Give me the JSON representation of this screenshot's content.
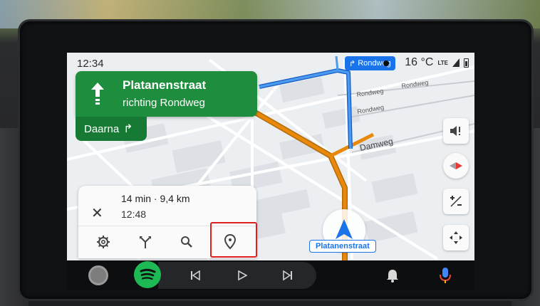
{
  "status": {
    "time": "12:34",
    "temperature": "16 °C",
    "network": "LTE",
    "next_road": "Rondweg"
  },
  "navigation": {
    "street": "Platanenstraat",
    "direction": "richting  Rondweg",
    "then_label": "Daarna"
  },
  "trip": {
    "summary": "14 min · 9,4 km",
    "eta": "12:48"
  },
  "map": {
    "labels": {
      "rondweg_1": "Rondweg",
      "rondweg_2": "Rondweg",
      "rondweg_3": "Rondweg",
      "damweg": "Damweg",
      "current_street": "Platanenstraat"
    }
  },
  "controls": {
    "mute_icon": "volume-alert-icon",
    "compass_icon": "compass-icon",
    "zoom_icon": "plus-minus-icon",
    "recenter_icon": "recenter-icon"
  },
  "trip_actions": [
    "settings-icon",
    "alt-routes-icon",
    "search-icon",
    "pin-icon"
  ],
  "media": {
    "app": "Spotify",
    "buttons": [
      "previous-icon",
      "play-icon",
      "next-icon"
    ]
  },
  "colors": {
    "nav_green": "#1e8e3e",
    "route_blue": "#1a73e8",
    "route_orange": "#e8890c",
    "spotify_green": "#1db954",
    "highlight_red": "#e02020"
  }
}
